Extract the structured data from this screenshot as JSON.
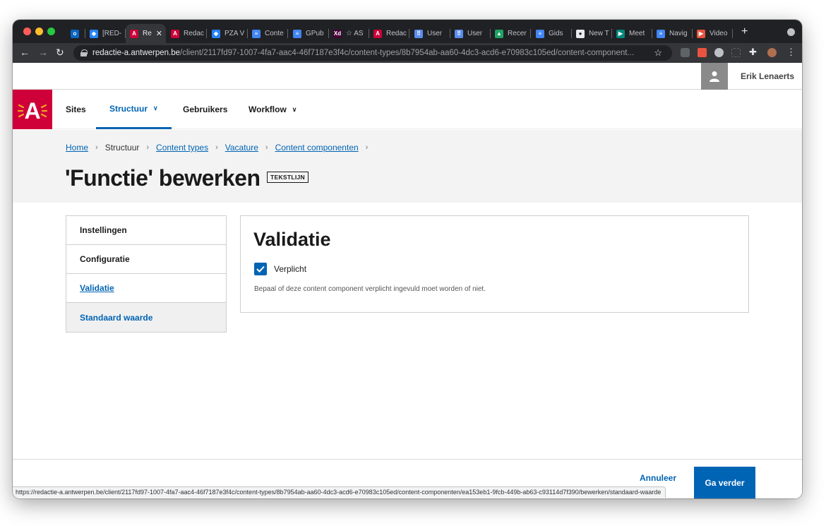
{
  "browser": {
    "tabs": [
      {
        "label": "",
        "color": "#0a66c2",
        "glyph": "o"
      },
      {
        "label": "[RED-",
        "color": "#2684ff",
        "glyph": "◆"
      },
      {
        "label": "Re",
        "color": "#cf0039",
        "glyph": "A",
        "active": true
      },
      {
        "label": "Redac",
        "color": "#cf0039",
        "glyph": "A"
      },
      {
        "label": "PZA V",
        "color": "#2684ff",
        "glyph": "◆"
      },
      {
        "label": "Conte",
        "color": "#4285f4",
        "glyph": "≡"
      },
      {
        "label": "GPub",
        "color": "#4285f4",
        "glyph": "≡"
      },
      {
        "label": "☆ AS",
        "color": "#470137",
        "glyph": "Xd"
      },
      {
        "label": "Redac",
        "color": "#cf0039",
        "glyph": "A"
      },
      {
        "label": "User",
        "color": "#5b8def",
        "glyph": "⠿"
      },
      {
        "label": "User",
        "color": "#5b8def",
        "glyph": "⠿"
      },
      {
        "label": "Recer",
        "color": "#1fa463",
        "glyph": "▲"
      },
      {
        "label": "Gids",
        "color": "#4285f4",
        "glyph": "≡"
      },
      {
        "label": "New T",
        "color": "#e8eaed",
        "glyph": "●"
      },
      {
        "label": "Meet",
        "color": "#00897b",
        "glyph": "▶"
      },
      {
        "label": "Navig",
        "color": "#4285f4",
        "glyph": "≡"
      },
      {
        "label": "Video",
        "color": "#e8543f",
        "glyph": "▶"
      }
    ],
    "url_host": "redactie-a.antwerpen.be",
    "url_path": "/client/2117fd97-1007-4fa7-aac4-46f7187e3f4c/content-types/8b7954ab-aa60-4dc3-acd6-e70983c105ed/content-component...",
    "status_url": "https://redactie-a.antwerpen.be/client/2117fd97-1007-4fa7-aac4-46f7187e3f4c/content-types/8b7954ab-aa60-4dc3-acd6-e70983c105ed/content-componenten/ea153eb1-9fcb-449b-ab63-c93114d7f390/bewerken/standaard-waarde"
  },
  "user": {
    "name": "Erik Lenaerts"
  },
  "nav": {
    "logo": "A",
    "items": [
      {
        "label": "Sites"
      },
      {
        "label": "Structuur",
        "active": true
      },
      {
        "label": "Gebruikers"
      },
      {
        "label": "Workflow"
      }
    ]
  },
  "breadcrumb": {
    "home": "Home",
    "structuur": "Structuur",
    "content_types": "Content types",
    "vacature": "Vacature",
    "content_componenten": "Content componenten"
  },
  "page": {
    "title": "'Functie' bewerken",
    "tag": "TEKSTLIJN"
  },
  "sidemenu": {
    "items": [
      {
        "label": "Instellingen"
      },
      {
        "label": "Configuratie"
      },
      {
        "label": "Validatie"
      },
      {
        "label": "Standaard waarde"
      }
    ]
  },
  "panel": {
    "heading": "Validatie",
    "checkbox_label": "Verplicht",
    "checkbox_checked": true,
    "help": "Bepaal of deze content component verplicht ingevuld moet worden of niet."
  },
  "footer": {
    "cancel": "Annuleer",
    "proceed": "Ga verder"
  },
  "colors": {
    "brand_red": "#cf0039",
    "link_blue": "#0064b4"
  }
}
